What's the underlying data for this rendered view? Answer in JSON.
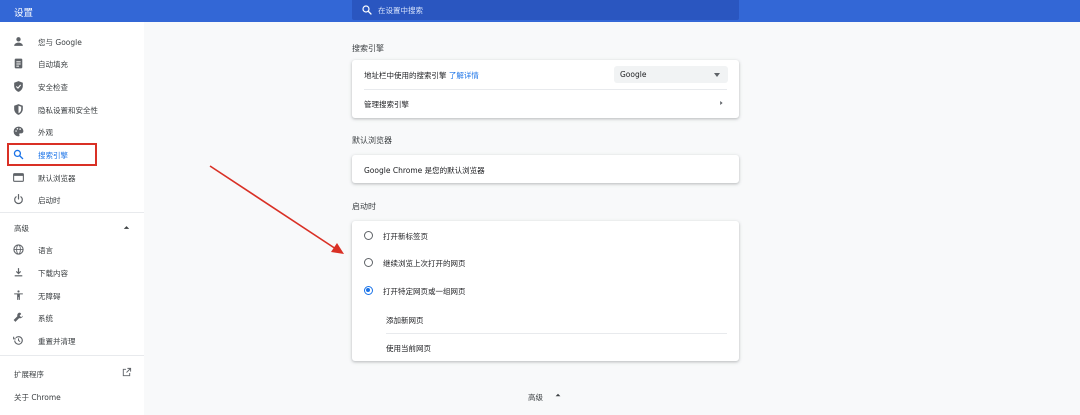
{
  "app": {
    "title": "设置"
  },
  "search": {
    "placeholder": "在设置中搜索",
    "icon": "search-icon"
  },
  "sidebar": {
    "items": [
      {
        "label": "您与 Google",
        "icon": "person-icon"
      },
      {
        "label": "自动填充",
        "icon": "clipboard-icon"
      },
      {
        "label": "安全检查",
        "icon": "shield-check-icon"
      },
      {
        "label": "隐私设置和安全性",
        "icon": "shield-half-icon"
      },
      {
        "label": "外观",
        "icon": "palette-icon"
      },
      {
        "label": "搜索引擎",
        "icon": "search-icon",
        "active": true
      },
      {
        "label": "默认浏览器",
        "icon": "browser-window-icon"
      },
      {
        "label": "启动时",
        "icon": "power-icon"
      }
    ],
    "advanced_label": "高级",
    "advanced_items": [
      {
        "label": "语言",
        "icon": "globe-icon"
      },
      {
        "label": "下载内容",
        "icon": "download-icon"
      },
      {
        "label": "无障碍",
        "icon": "accessibility-icon"
      },
      {
        "label": "系统",
        "icon": "wrench-icon"
      },
      {
        "label": "重置并清理",
        "icon": "history-icon"
      }
    ],
    "extensions_label": "扩展程序",
    "about_label": "关于 Chrome"
  },
  "search_engine": {
    "title": "搜索引擎",
    "address_bar_label": "地址栏中使用的搜索引擎",
    "learn_more": "了解详情",
    "selected_engine": "Google",
    "manage_label": "管理搜索引擎"
  },
  "default_browser": {
    "title": "默认浏览器",
    "status": "Google Chrome 是您的默认浏览器"
  },
  "startup": {
    "title": "启动时",
    "options": [
      {
        "label": "打开新标签页",
        "selected": false
      },
      {
        "label": "继续浏览上次打开的网页",
        "selected": false
      },
      {
        "label": "打开特定网页或一组网页",
        "selected": true
      }
    ],
    "add_page": "添加新网页",
    "use_current": "使用当前网页"
  },
  "footer": {
    "advanced_label": "高级"
  },
  "colors": {
    "header": "#3367d6",
    "accent": "#1a73e8",
    "annotation": "#d93025"
  }
}
